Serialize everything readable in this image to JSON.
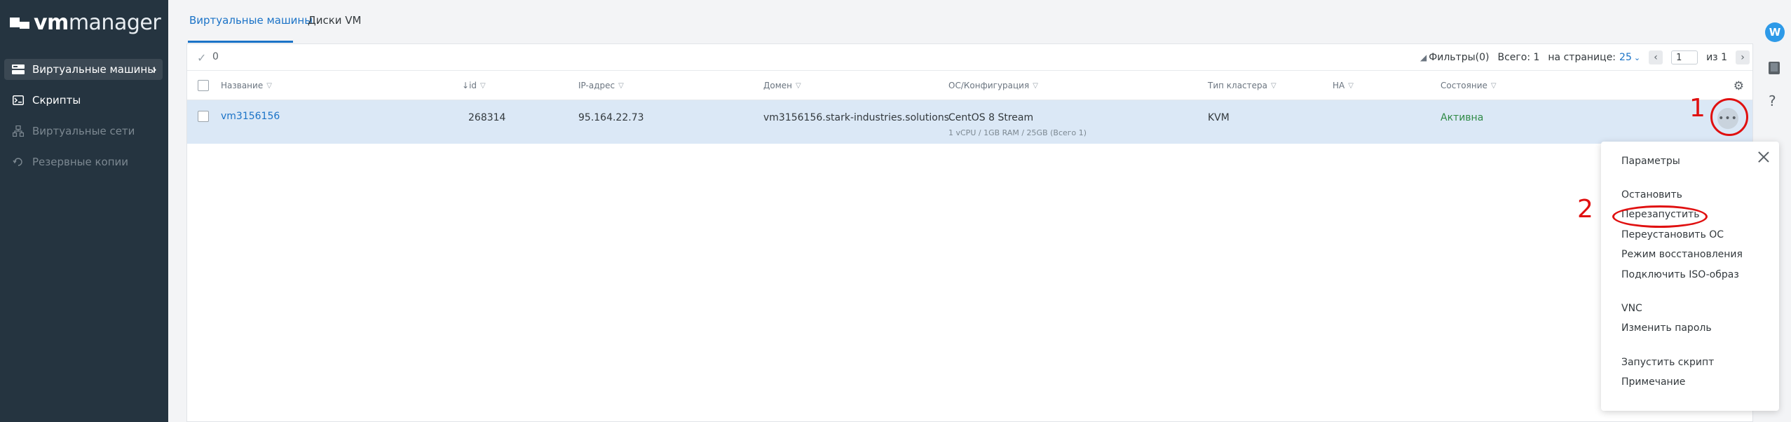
{
  "brand": {
    "logo_vm": "vm",
    "logo_manager": "manager"
  },
  "sidebar": {
    "items": [
      {
        "label": "Виртуальные машины",
        "icon": "servers-icon",
        "state": "active"
      },
      {
        "label": "Скрипты",
        "icon": "script-icon",
        "state": "normal"
      },
      {
        "label": "Виртуальные сети",
        "icon": "network-icon",
        "state": "disabled"
      },
      {
        "label": "Резервные копии",
        "icon": "backup-icon",
        "state": "disabled"
      }
    ]
  },
  "tabs": [
    {
      "label": "Виртуальные машины",
      "active": true
    },
    {
      "label": "Диски VM",
      "active": false
    }
  ],
  "toolbar": {
    "selected_count": "0",
    "filters_label": "Фильтры(0)",
    "total_label": "Всего: 1",
    "per_page_label": "на странице:",
    "per_page_value": "25",
    "page_value": "1",
    "page_of": "из",
    "page_total": "1"
  },
  "table": {
    "columns": [
      "Название",
      "id",
      "IP-адрес",
      "Домен",
      "ОС/Конфигурация",
      "Тип кластера",
      "HA",
      "Состояние"
    ],
    "sort_indicator": "↓",
    "rows": [
      {
        "name": "vm3156156",
        "id": "268314",
        "ip": "95.164.22.73",
        "domain": "vm3156156.stark-industries.solutions",
        "os": "CentOS 8 Stream",
        "config": "1 vCPU / 1GB RAM / 25GB (Всего 1)",
        "cluster_type": "KVM",
        "ha": "",
        "status": "Активна"
      }
    ]
  },
  "menu": {
    "items": [
      "Параметры",
      "Остановить",
      "Перезапустить",
      "Переустановить ОС",
      "Режим восстановления",
      "Подключить ISO-образ",
      "VNC",
      "Изменить пароль",
      "Запустить скрипт",
      "Примечание"
    ]
  },
  "user": {
    "avatar_letter": "W"
  },
  "annotations": {
    "step1": "1",
    "step2": "2"
  },
  "colors": {
    "accent": "#1b73c7",
    "sidebar_bg": "#253440",
    "row_selected": "#dbe8f6",
    "status_active": "#2f8a46",
    "annotation": "#e01010"
  }
}
